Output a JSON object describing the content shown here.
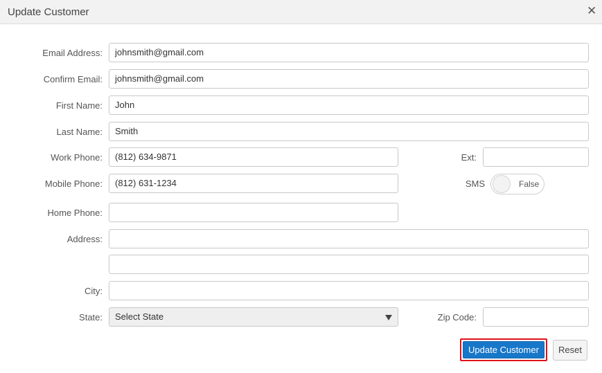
{
  "dialog": {
    "title": "Update Customer",
    "close_icon": "close-icon"
  },
  "form": {
    "email": {
      "label": "Email Address:",
      "value": "johnsmith@gmail.com"
    },
    "confirm_email": {
      "label": "Confirm Email:",
      "value": "johnsmith@gmail.com"
    },
    "first_name": {
      "label": "First Name:",
      "value": "John"
    },
    "last_name": {
      "label": "Last Name:",
      "value": "Smith"
    },
    "work_phone": {
      "label": "Work Phone:",
      "value": "(812) 634-9871"
    },
    "ext": {
      "label": "Ext:",
      "value": ""
    },
    "mobile_phone": {
      "label": "Mobile Phone:",
      "value": "(812) 631-1234"
    },
    "sms": {
      "label": "SMS",
      "state_text": "False"
    },
    "home_phone": {
      "label": "Home Phone:",
      "value": ""
    },
    "address": {
      "label": "Address:",
      "line1": "",
      "line2": ""
    },
    "city": {
      "label": "City:",
      "value": ""
    },
    "state": {
      "label": "State:",
      "selected": "Select State"
    },
    "zip": {
      "label": "Zip Code:",
      "value": ""
    }
  },
  "actions": {
    "update_label": "Update Customer",
    "reset_label": "Reset"
  },
  "colors": {
    "primary": "#1777c9",
    "highlight_border": "#e0111b"
  }
}
